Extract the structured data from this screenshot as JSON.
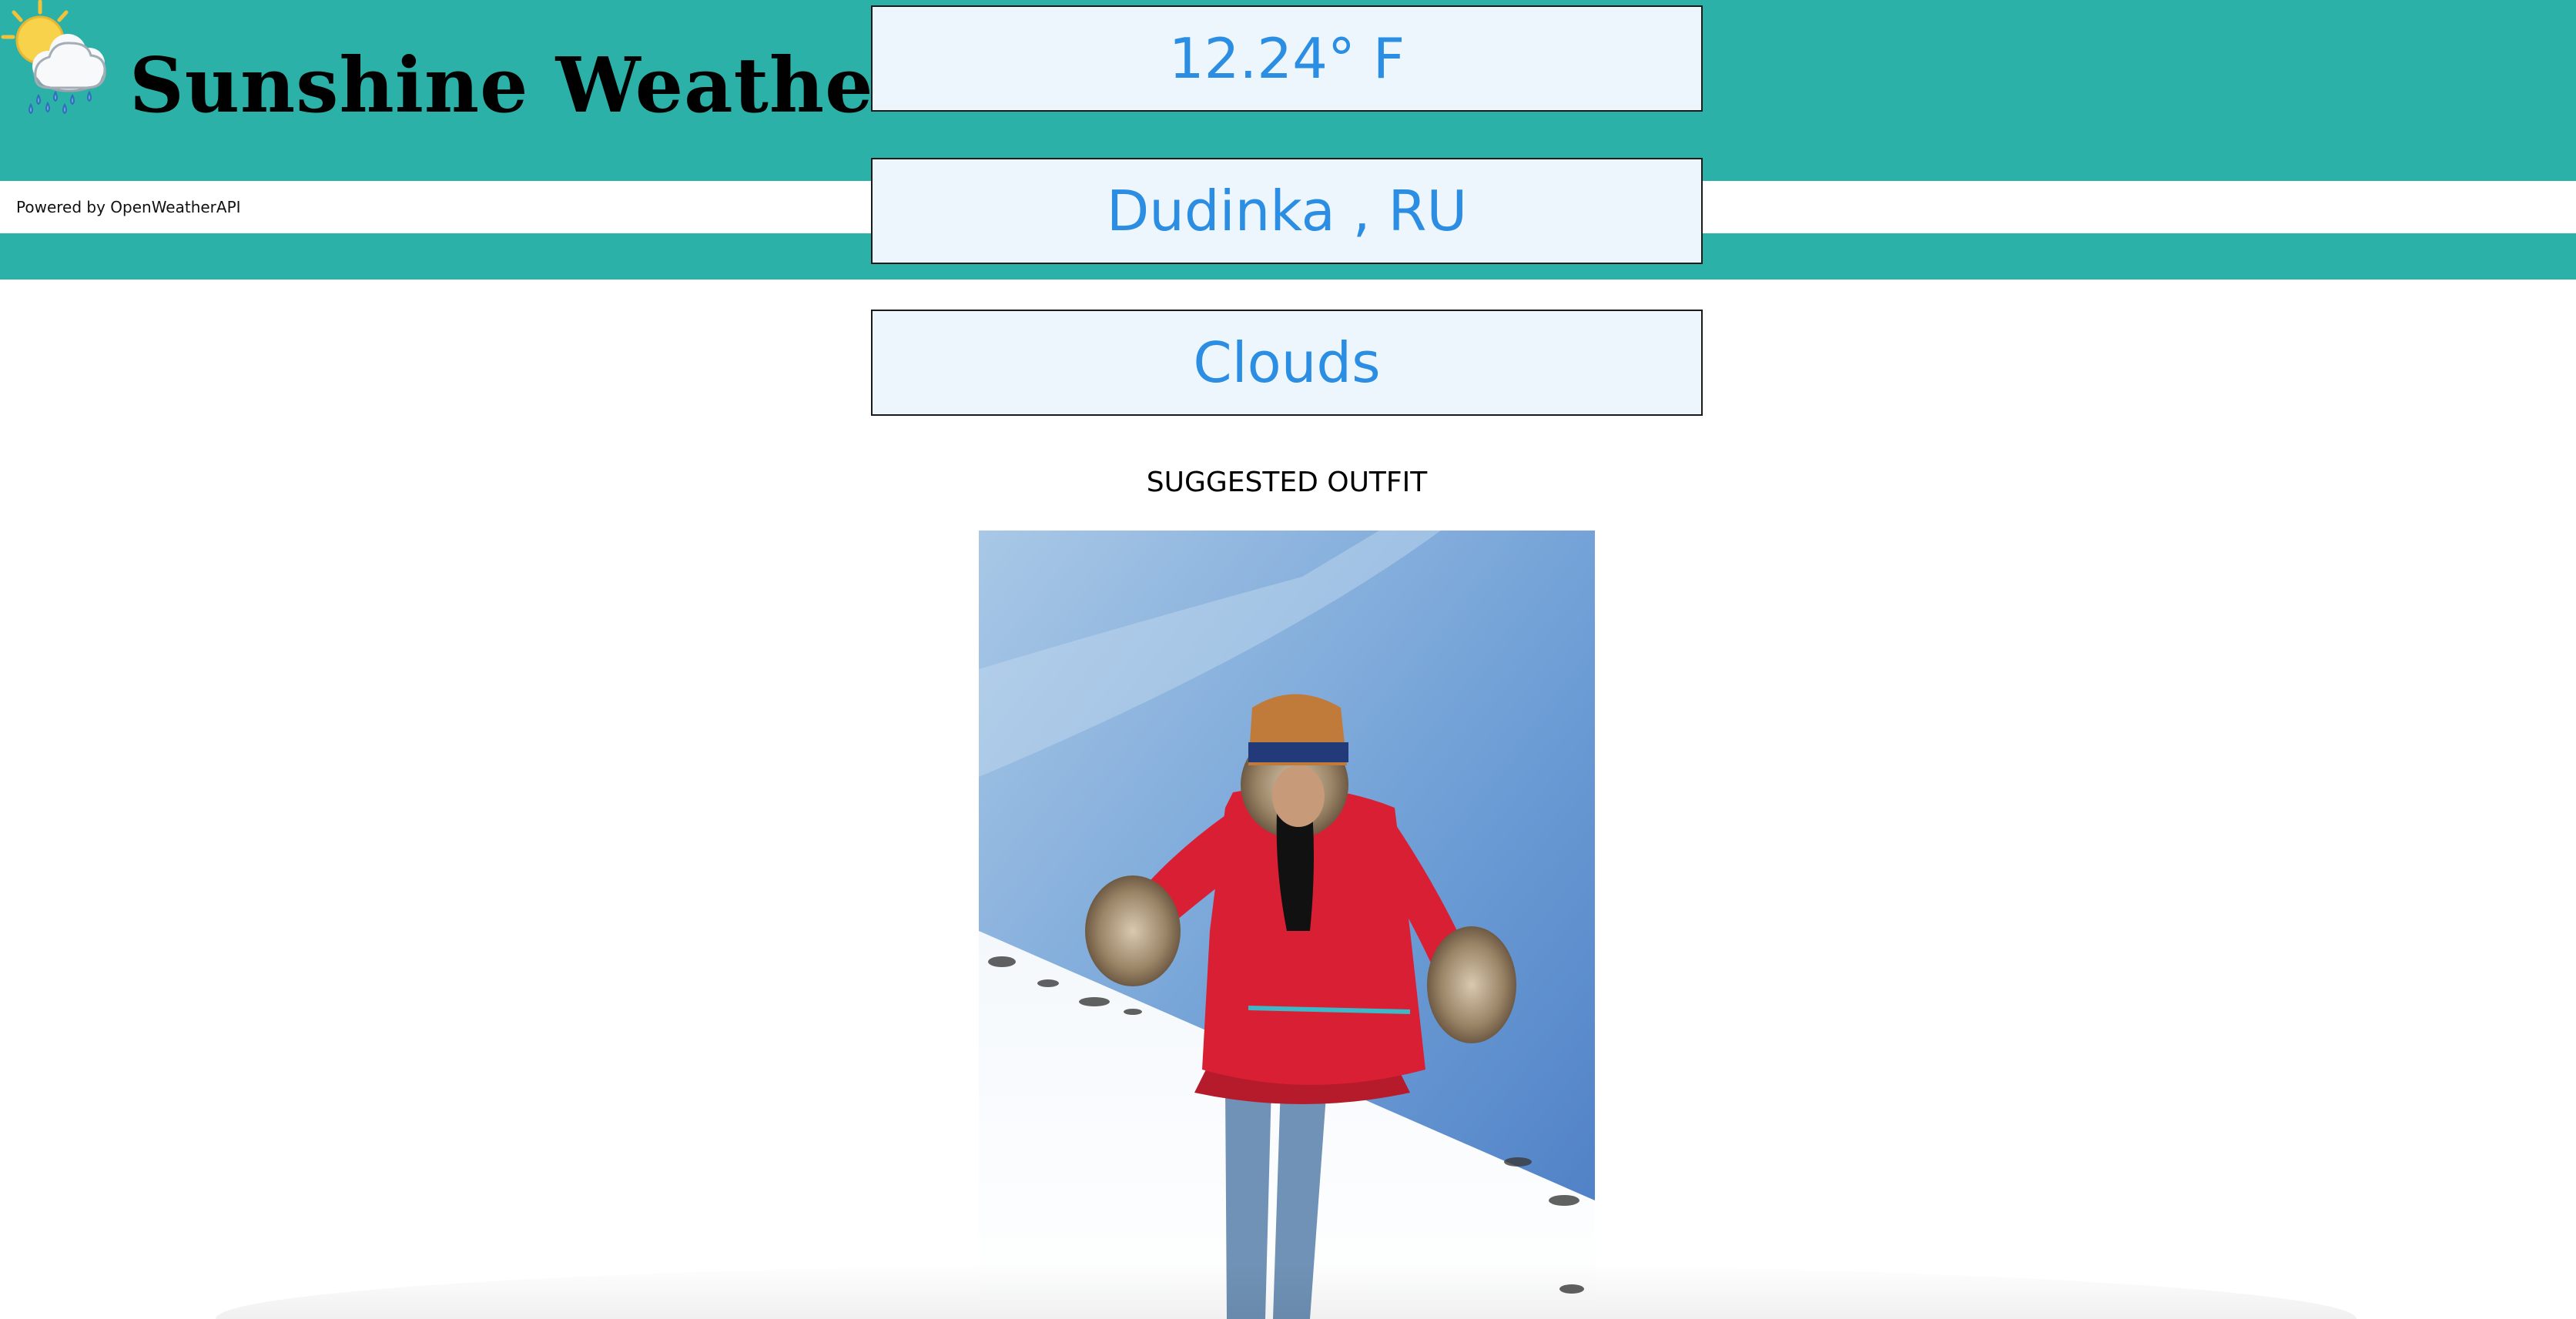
{
  "header": {
    "app_title": "Sunshine Weather",
    "logo_icon": "sun-cloud-rain-icon",
    "powered_by": "Powered by OpenWeatherAPI"
  },
  "weather": {
    "temperature": "12.24° F",
    "location": "Dudinka , RU",
    "condition": "Clouds"
  },
  "outfit": {
    "label": "SUGGESTED OUTFIT",
    "image_description_icon": "outfit-photo"
  },
  "colors": {
    "header_teal": "#2cb1a8",
    "box_background": "#eef6fd",
    "box_text_blue": "#2b8ee3"
  }
}
